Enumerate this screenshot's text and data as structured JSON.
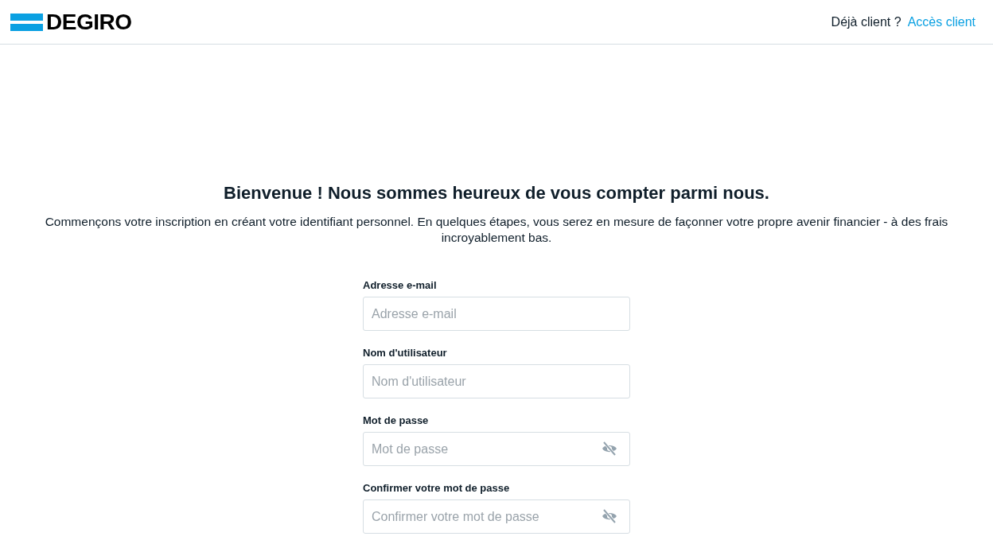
{
  "header": {
    "logo": "DEGIRO",
    "prompt": "Déjà client ?",
    "login_link": "Accès client"
  },
  "heading": "Bienvenue ! Nous sommes heureux de vous compter parmi nous.",
  "intro": "Commençons votre inscription en créant votre identifiant personnel. En quelques étapes, vous serez en mesure de façonner votre propre avenir financier - à des frais incroyablement bas.",
  "fields": [
    {
      "label": "Adresse e-mail",
      "placeholder": "Adresse e-mail",
      "kind": "text"
    },
    {
      "label": "Nom d'utilisateur",
      "placeholder": "Nom d'utilisateur",
      "kind": "text"
    },
    {
      "label": "Mot de passe",
      "placeholder": "Mot de passe",
      "kind": "password"
    },
    {
      "label": "Confirmer votre mot de passe",
      "placeholder": "Confirmer votre mot de passe",
      "kind": "password"
    }
  ]
}
